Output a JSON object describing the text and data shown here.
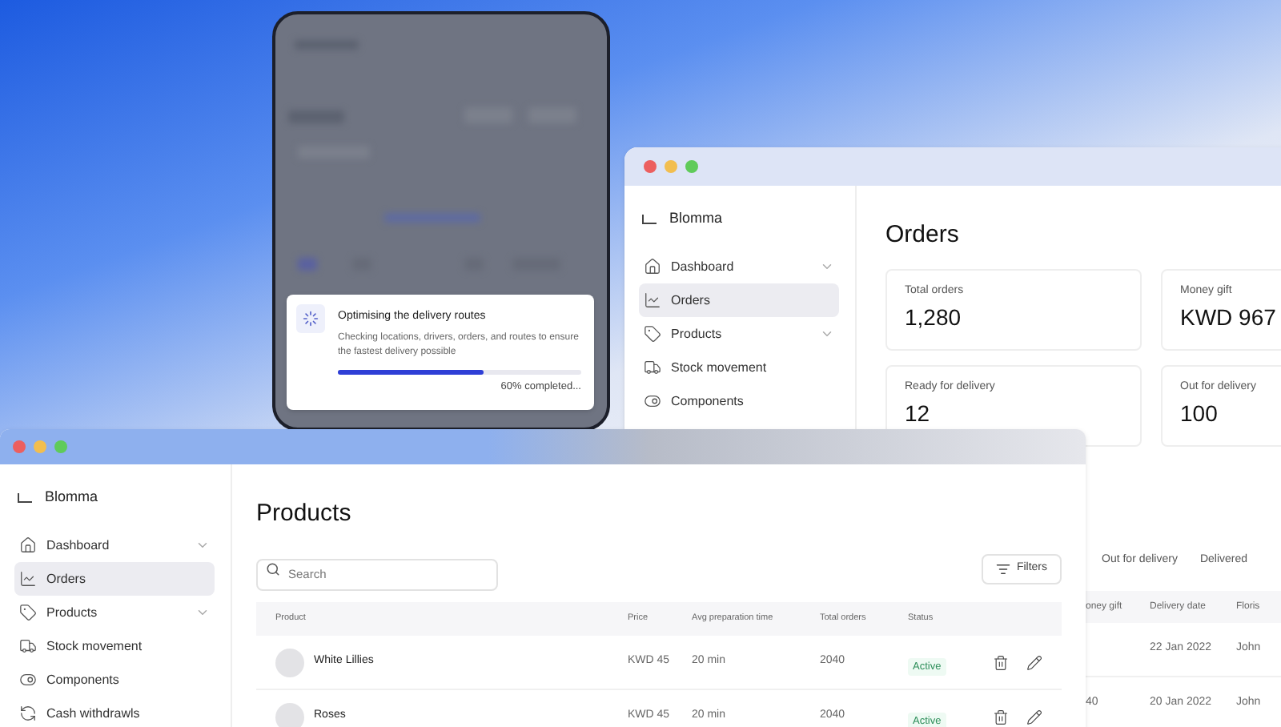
{
  "toast": {
    "title": "Optimising the delivery routes",
    "description": "Checking locations, drivers, orders, and routes to ensure the fastest delivery possible",
    "level": 0.6,
    "progress_text": "60% completed..."
  },
  "orders_window": {
    "brand": "Blomma",
    "sidebar": {
      "items": [
        {
          "label": "Dashboard",
          "kind": "group",
          "selected": false
        },
        {
          "label": "Orders",
          "kind": "link",
          "selected": true
        },
        {
          "label": "Products",
          "kind": "group",
          "selected": false
        },
        {
          "label": "Stock movement",
          "kind": "link",
          "selected": false
        },
        {
          "label": "Components",
          "kind": "link",
          "selected": false
        }
      ]
    },
    "title": "Orders",
    "stats": [
      {
        "label": "Total orders",
        "value": "1,280"
      },
      {
        "label": "Money gift",
        "value": "KWD 967"
      },
      {
        "label": "Ready for delivery",
        "value": "12"
      },
      {
        "label": "Out for delivery",
        "value": "100"
      }
    ],
    "tabs": [
      {
        "label": "Out for delivery",
        "selected": false
      },
      {
        "label": "Delivered",
        "selected": false
      }
    ],
    "table": {
      "columns": [
        "oney gift",
        "Delivery date",
        "Floris"
      ],
      "rows": [
        [
          "",
          "22 Jan 2022",
          "John"
        ],
        [
          "40",
          "20 Jan 2022",
          "John"
        ]
      ]
    }
  },
  "products_window": {
    "brand": "Blomma",
    "sidebar": {
      "items": [
        {
          "label": "Dashboard",
          "kind": "group",
          "selected": false
        },
        {
          "label": "Orders",
          "kind": "link",
          "selected": true
        },
        {
          "label": "Products",
          "kind": "group",
          "selected": false
        },
        {
          "label": "Stock movement",
          "kind": "link",
          "selected": false
        },
        {
          "label": "Components",
          "kind": "link",
          "selected": false
        },
        {
          "label": "Cash withdrawls",
          "kind": "link",
          "selected": false
        }
      ]
    },
    "title": "Products",
    "search": {
      "placeholder": "Search"
    },
    "filters_button": "Filters",
    "table": {
      "columns": [
        "Product",
        "Price",
        "Avg preparation time",
        "Total orders",
        "Status"
      ],
      "rows": [
        {
          "product": "White Lillies",
          "price": "KWD 45",
          "prep_time": "20 min",
          "total_orders": "2040",
          "status": "Active"
        },
        {
          "product": "Roses",
          "price": "KWD 45",
          "prep_time": "20 min",
          "total_orders": "2040",
          "status": "Active"
        }
      ]
    }
  }
}
